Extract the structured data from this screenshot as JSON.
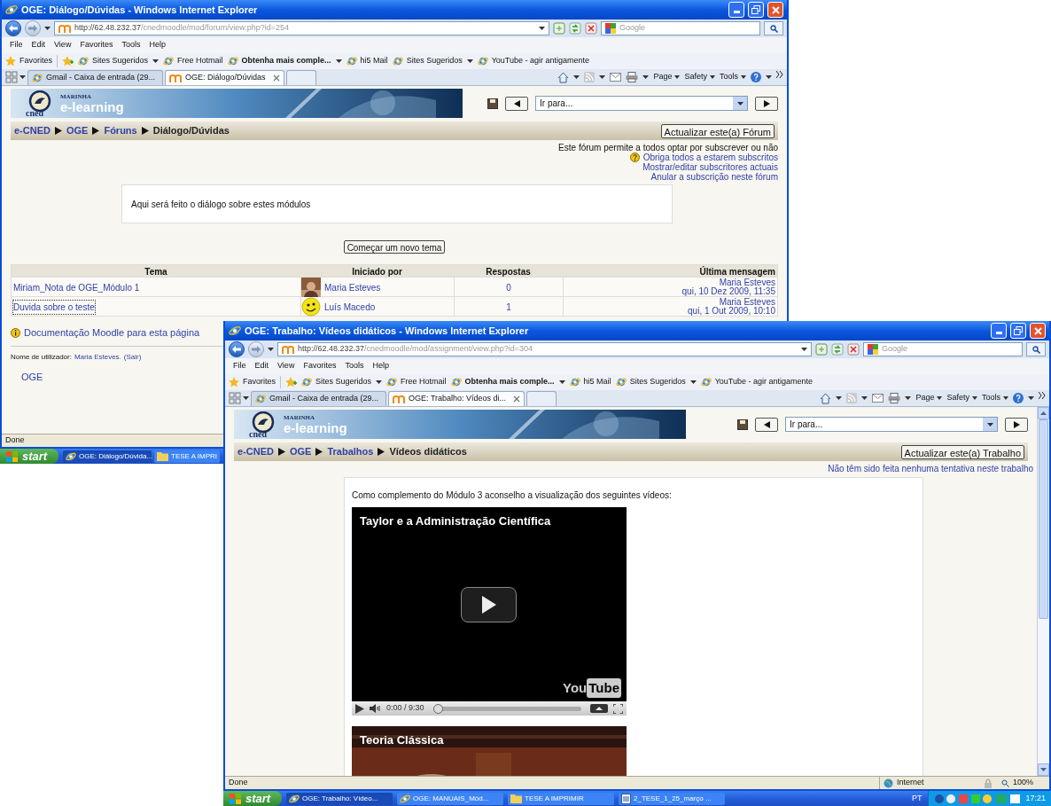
{
  "windows": [
    {
      "kind": "forum",
      "title": "OGE: Diálogo/Dúvidas - Windows Internet Explorer",
      "address": {
        "host": "http://62.48.232.37",
        "path": "/cnedmoodle/mod/forum/view.php?id=254"
      },
      "search_placeholder": "Google",
      "menu": [
        "File",
        "Edit",
        "View",
        "Favorites",
        "Tools",
        "Help"
      ],
      "favorites": {
        "label": "Favorites",
        "links": [
          {
            "label": "Sites Sugeridos",
            "dropdown": true,
            "bold": false
          },
          {
            "label": "Free Hotmail",
            "dropdown": false,
            "bold": false
          },
          {
            "label": "Obtenha mais comple...",
            "dropdown": true,
            "bold": true
          },
          {
            "label": "hi5 Mail",
            "dropdown": false,
            "bold": false
          },
          {
            "label": "Sites Sugeridos",
            "dropdown": true,
            "bold": false
          },
          {
            "label": "YouTube - agir antigamente",
            "dropdown": false,
            "bold": false
          }
        ]
      },
      "tabs": [
        {
          "label": "Gmail - Caixa de entrada (29...",
          "selected": false
        },
        {
          "label": "OGE: Diálogo/Dúvidas",
          "selected": true
        }
      ],
      "command_bar": [
        "Page",
        "Safety",
        "Tools"
      ],
      "site": {
        "brand_top": "MARINHA",
        "brand": "e-learning",
        "logo_caption": "cned",
        "jump_placeholder": "Ir para...",
        "breadcrumb": [
          {
            "label": "e-CNED",
            "link": true
          },
          {
            "label": "OGE",
            "link": true
          },
          {
            "label": "Fóruns",
            "link": true
          },
          {
            "label": "Diálogo/Dúvidas",
            "link": false
          }
        ],
        "update_button": "Actualizar este(a) Fórum"
      },
      "forum": {
        "subscribe_note": "Este fórum permite a todos optar por subscrever ou não",
        "links": [
          "Obriga todos a estarem subscritos",
          "Mostrar/editar subscritores actuais",
          "Anular a subscrição neste fórum"
        ],
        "intro": "Aqui será feito o diálogo sobre estes módulos",
        "new_topic_button": "Começar um novo tema",
        "columns": [
          "Tema",
          "Iniciado por",
          "Respostas",
          "Última mensagem"
        ],
        "rows": [
          {
            "topic": "Miriam_Nota de OGE_Módulo 1",
            "author": "Maria Esteves",
            "replies": "0",
            "last_author": "Maria Esteves",
            "last_date": "qui, 10 Dez 2009, 11:35",
            "focused": false
          },
          {
            "topic": "Duvida sobre o teste",
            "kind": "smiley",
            "author": "Luís Macedo",
            "replies": "1",
            "last_author": "Maria Esteves",
            "last_date": "qui, 1 Out 2009, 10:10",
            "focused": true
          }
        ],
        "docs_link": "Documentação Moodle para esta página",
        "user_label": "Nome de utilizador:",
        "user_name": "Maria Esteves.",
        "logout": "(Sair)",
        "course_link": "OGE"
      },
      "status": {
        "text": "Done"
      },
      "taskbar": {
        "start": "start",
        "items": [
          {
            "label": "OGE: Diálogo/Dúvida...",
            "kind": "browser",
            "selected": true
          },
          {
            "label": "TESE A IMPRI",
            "kind": "folder",
            "selected": false
          }
        ]
      }
    },
    {
      "kind": "assignment",
      "title": "OGE: Trabalho: Vídeos didáticos - Windows Internet Explorer",
      "address": {
        "host": "http://62.48.232.37",
        "path": "/cnedmoodle/mod/assignment/view.php?id=304"
      },
      "search_placeholder": "Google",
      "menu": [
        "File",
        "Edit",
        "View",
        "Favorites",
        "Tools",
        "Help"
      ],
      "favorites": {
        "label": "Favorites",
        "links": [
          {
            "label": "Sites Sugeridos",
            "dropdown": true,
            "bold": false
          },
          {
            "label": "Free Hotmail",
            "dropdown": false,
            "bold": false
          },
          {
            "label": "Obtenha mais comple...",
            "dropdown": true,
            "bold": true
          },
          {
            "label": "hi5 Mail",
            "dropdown": false,
            "bold": false
          },
          {
            "label": "Sites Sugeridos",
            "dropdown": true,
            "bold": false
          },
          {
            "label": "YouTube - agir antigamente",
            "dropdown": false,
            "bold": false
          }
        ]
      },
      "tabs": [
        {
          "label": "Gmail - Caixa de entrada (29...",
          "selected": false
        },
        {
          "label": "OGE: Trabalho: Vídeos di...",
          "selected": true
        }
      ],
      "command_bar": [
        "Page",
        "Safety",
        "Tools"
      ],
      "site": {
        "brand_top": "MARINHA",
        "brand": "e-learning",
        "logo_caption": "cned",
        "jump_placeholder": "Ir para...",
        "breadcrumb": [
          {
            "label": "e-CNED",
            "link": true
          },
          {
            "label": "OGE",
            "link": true
          },
          {
            "label": "Trabalhos",
            "link": true
          },
          {
            "label": "Vídeos didáticos",
            "link": false
          }
        ],
        "update_button": "Actualizar este(a) Trabalho"
      },
      "assignment": {
        "attempts_note": "Não têm sido feita nenhuma tentativa neste trabalho",
        "intro": "Como complemento do Módulo 3 aconselho a visualização dos seguintes vídeos:",
        "videos": [
          {
            "kind": "black",
            "title": "Taylor e a Administração Científica",
            "logo": [
              "You",
              "Tube"
            ],
            "time": "0:00 / 9:30",
            "level": 0
          },
          {
            "kind": "picture",
            "title": "Teoria Clássica"
          }
        ]
      },
      "status": {
        "text": "Done",
        "zone": "Internet",
        "zoom": "100%"
      },
      "taskbar": {
        "start": "start",
        "items": [
          {
            "label": "OGE: Trabalho: Vídeo...",
            "kind": "browser",
            "selected": true
          },
          {
            "label": "OGE: MANUAIS_Mód...",
            "kind": "browser",
            "selected": false
          },
          {
            "label": "TESE A IMPRIMIR",
            "kind": "folder",
            "selected": false
          },
          {
            "label": "2_TESE_1_25_março ...",
            "kind": "document",
            "selected": false
          }
        ],
        "language": "PT",
        "clock": "17:21"
      }
    }
  ]
}
